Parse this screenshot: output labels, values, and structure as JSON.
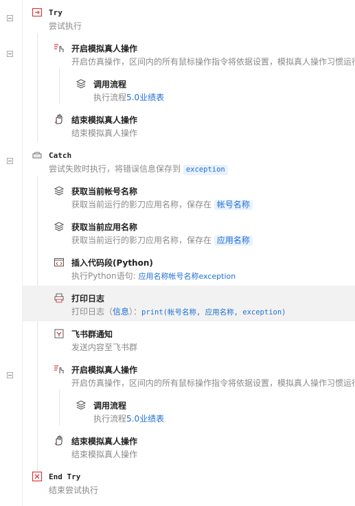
{
  "steps": {
    "try": {
      "title": "Try",
      "desc": "尝试执行"
    },
    "sim1": {
      "title": "开启模拟真人操作",
      "desc": "开启仿真操作，区间内的所有鼠标操作指令将依据设置，模拟真人操作习惯运行"
    },
    "call1": {
      "title": "调用流程",
      "desc_prefix": "执行流程",
      "link": "5.0业绩表"
    },
    "end_sim1": {
      "title": "结束模拟真人操作",
      "desc": "结束模拟真人操作"
    },
    "catch": {
      "title": "Catch",
      "desc_prefix": "尝试失败时执行，将错误信息保存到",
      "var": "exception"
    },
    "acct": {
      "title": "获取当前帐号名称",
      "desc_prefix": "获取当前运行的影刀应用名称，保存在",
      "var": "帐号名称"
    },
    "app": {
      "title": "获取当前应用名称",
      "desc_prefix": "获取当前运行的影刀应用名称，保存在",
      "var": "应用名称"
    },
    "code": {
      "title": "插入代码段(Python)",
      "desc_prefix": "执行Python语句:",
      "code": "应用名称帐号名称exception"
    },
    "log": {
      "title": "打印日志",
      "desc_prefix": "打印日志（",
      "level": "信息",
      "mid": "）：",
      "expr": "print(帐号名称, 应用名称, exception)"
    },
    "feishu": {
      "title": "飞书群通知",
      "desc": "发送内容至飞书群"
    },
    "sim2": {
      "title": "开启模拟真人操作",
      "desc": "开启仿真操作，区间内的所有鼠标操作指令将依据设置，模拟真人操作习惯运行"
    },
    "call2": {
      "title": "调用流程",
      "desc_prefix": "执行流程",
      "link": "5.0业绩表"
    },
    "end_sim2": {
      "title": "结束模拟真人操作",
      "desc": "结束模拟真人操作"
    },
    "endtry": {
      "title": "End Try",
      "desc": "结束尝试执行"
    }
  },
  "colors": {
    "accent": "#1f6fd1",
    "danger": "#d93a3a",
    "highlight": "#f2f2f2"
  }
}
